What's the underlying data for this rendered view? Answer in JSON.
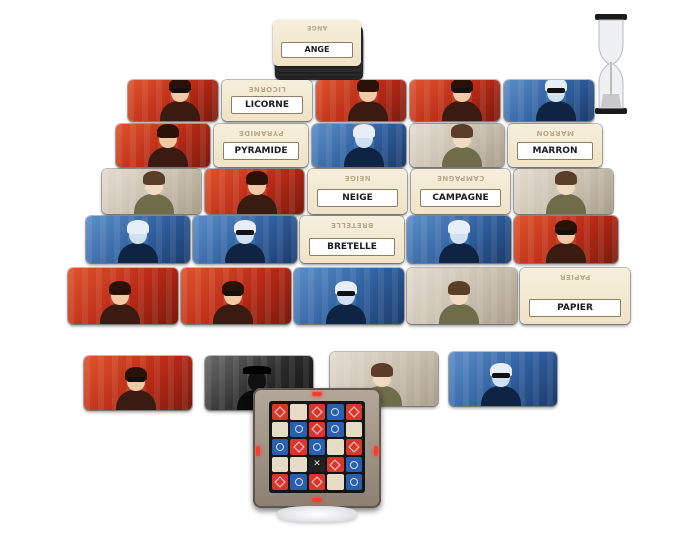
{
  "scene": {
    "deck_top_word": "ANGE",
    "deck_top_word_mirror": "ANGE"
  },
  "grid": {
    "rows": [
      [
        {
          "type": "agent",
          "color": "red",
          "shades": true
        },
        {
          "type": "word",
          "word": "LICORNE",
          "mirror": "LICORNE"
        },
        {
          "type": "agent",
          "color": "red",
          "shades": false
        },
        {
          "type": "agent",
          "color": "red",
          "shades": true
        },
        {
          "type": "agent",
          "color": "blue",
          "shades": true
        }
      ],
      [
        {
          "type": "agent",
          "color": "red",
          "shades": false
        },
        {
          "type": "word",
          "word": "PYRAMIDE",
          "mirror": "PYRAMIDE"
        },
        {
          "type": "agent",
          "color": "blue",
          "shades": false
        },
        {
          "type": "agent",
          "color": "beige",
          "shades": false
        },
        {
          "type": "word",
          "word": "MARRON",
          "mirror": "MARRON"
        }
      ],
      [
        {
          "type": "agent",
          "color": "beige",
          "shades": false
        },
        {
          "type": "agent",
          "color": "red",
          "shades": false
        },
        {
          "type": "word",
          "word": "NEIGE",
          "mirror": "NEIGE"
        },
        {
          "type": "word",
          "word": "CAMPAGNE",
          "mirror": "CAMPAGNE"
        },
        {
          "type": "agent",
          "color": "beige",
          "shades": false
        }
      ],
      [
        {
          "type": "agent",
          "color": "blue",
          "shades": false
        },
        {
          "type": "agent",
          "color": "blue",
          "shades": true
        },
        {
          "type": "word",
          "word": "BRETELLE",
          "mirror": "BRETELLE"
        },
        {
          "type": "agent",
          "color": "blue",
          "shades": false
        },
        {
          "type": "agent",
          "color": "red",
          "shades": true
        }
      ],
      [
        {
          "type": "agent",
          "color": "red",
          "shades": false
        },
        {
          "type": "agent",
          "color": "red",
          "shades": true
        },
        {
          "type": "agent",
          "color": "blue",
          "shades": true
        },
        {
          "type": "agent",
          "color": "beige",
          "shades": false
        },
        {
          "type": "word",
          "word": "PAPIER",
          "mirror": "PAPIER"
        }
      ]
    ]
  },
  "reserve_cards": [
    {
      "type": "agent",
      "color": "red",
      "shades": true
    },
    {
      "type": "agent",
      "color": "black",
      "shades": false
    },
    {
      "type": "agent",
      "color": "beige",
      "shades": false
    },
    {
      "type": "agent",
      "color": "blue",
      "shades": true
    }
  ],
  "key_card": {
    "cells": [
      [
        "red",
        "neutral",
        "red",
        "blue",
        "red"
      ],
      [
        "neutral",
        "blue",
        "red",
        "blue",
        "neutral"
      ],
      [
        "blue",
        "red",
        "blue",
        "neutral",
        "red"
      ],
      [
        "neutral",
        "neutral",
        "assassin",
        "red",
        "blue"
      ],
      [
        "red",
        "blue",
        "red",
        "neutral",
        "blue"
      ]
    ]
  },
  "colors": {
    "red_team": "#d8382c",
    "blue_team": "#2a5fb0",
    "neutral": "#e6dcc6",
    "assassin": "#222222",
    "led": "#ff3b2e"
  }
}
